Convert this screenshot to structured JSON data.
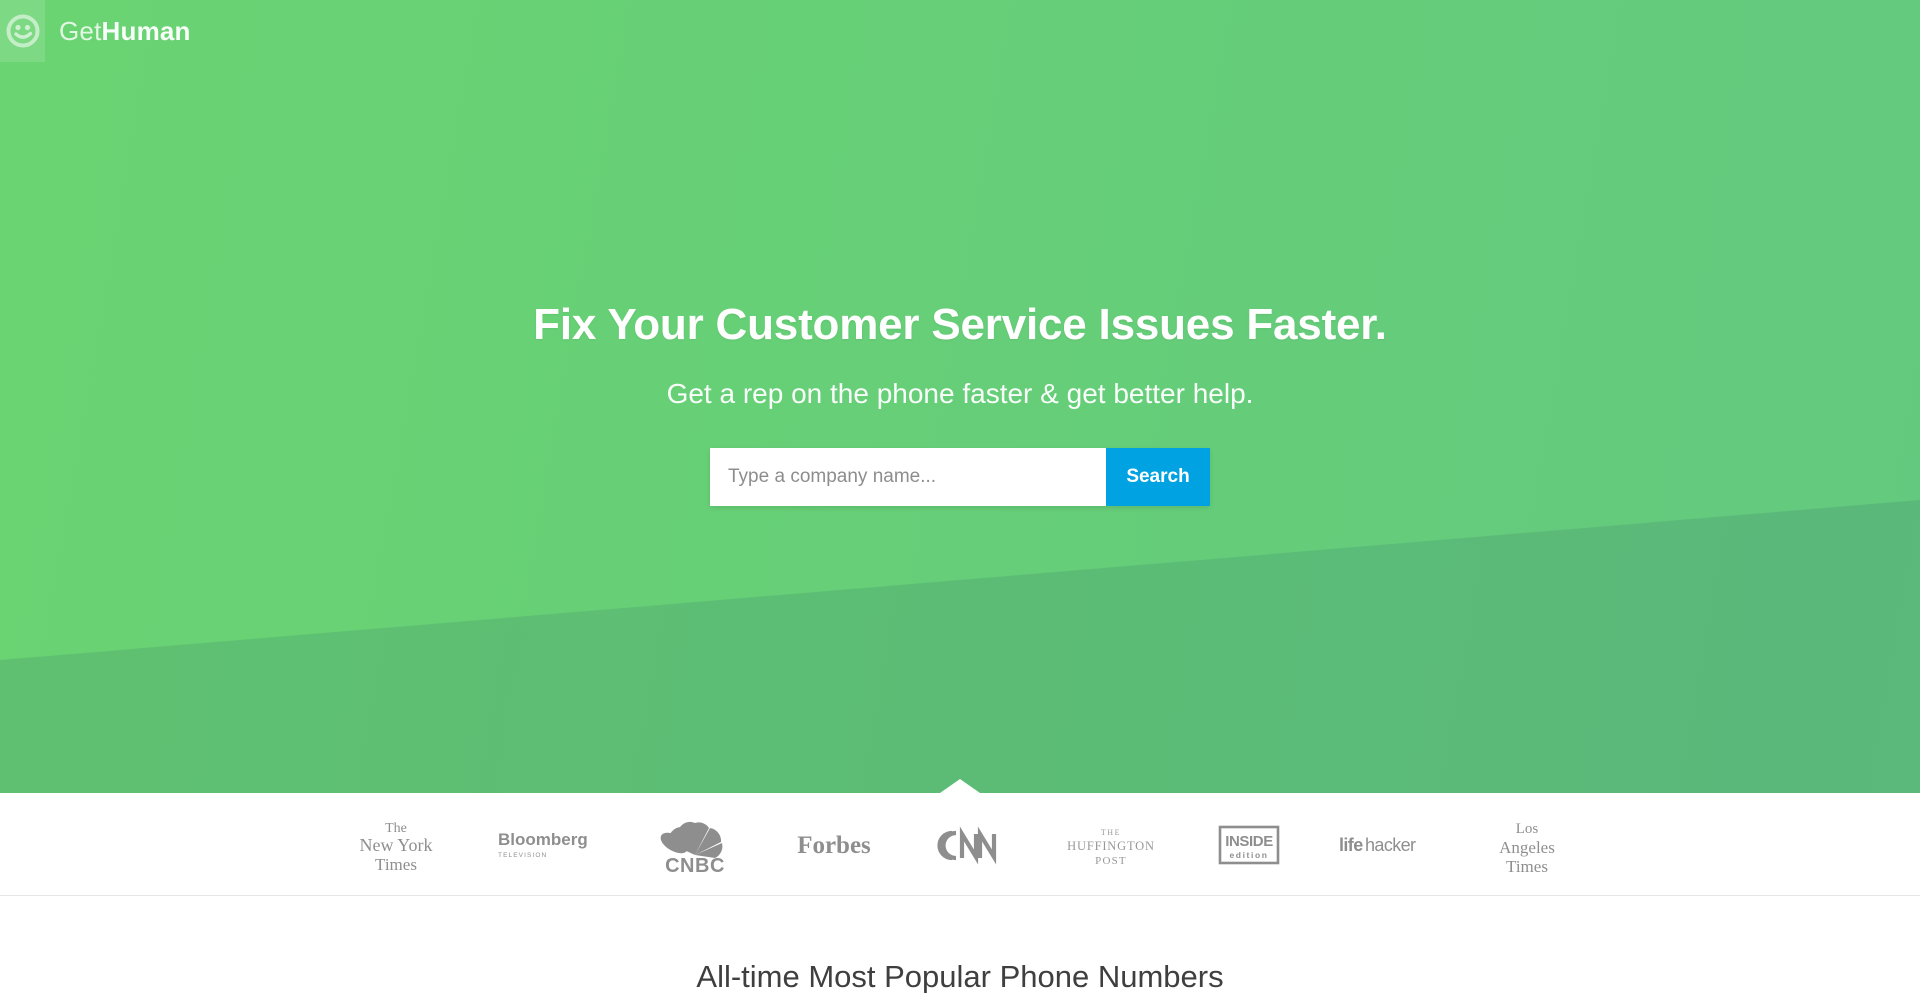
{
  "header": {
    "logo_icon": "smiley-face-icon",
    "brand_get": "Get",
    "brand_human": "Human"
  },
  "hero": {
    "title": "Fix Your Customer Service Issues Faster.",
    "subtitle": "Get a rep on the phone faster & get better help.",
    "background_gradient_from": "#6ad472",
    "background_gradient_to": "#63c97f",
    "wedge_color": "rgba(60,130,110,0.22)"
  },
  "search": {
    "placeholder": "Type a company name...",
    "value": "",
    "button_label": "Search",
    "button_color": "#00a2e1"
  },
  "press": {
    "logos": [
      {
        "name": "the-new-york-times",
        "line1": "The",
        "line2": "New York",
        "line3": "Times"
      },
      {
        "name": "bloomberg-television",
        "line1": "Bloomberg",
        "line2": "TELEVISION"
      },
      {
        "name": "cnbc",
        "line1": "CNBC"
      },
      {
        "name": "forbes",
        "line1": "Forbes"
      },
      {
        "name": "cnn",
        "line1": "CNN"
      },
      {
        "name": "the-huffington-post",
        "line1": "THE",
        "line2": "HUFFINGTON",
        "line3": "POST"
      },
      {
        "name": "inside-edition",
        "line1": "INSIDE",
        "line2": "edition"
      },
      {
        "name": "lifehacker",
        "line1": "life",
        "line2": "hacker"
      },
      {
        "name": "los-angeles-times",
        "line1": "Los",
        "line2": "Angeles",
        "line3": "Times"
      }
    ]
  },
  "popular": {
    "title": "All-time Most Popular Phone Numbers"
  }
}
